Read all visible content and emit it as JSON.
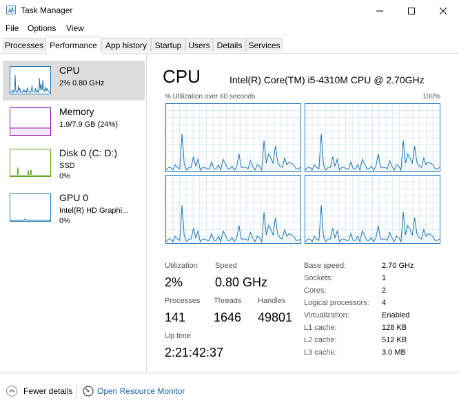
{
  "window": {
    "title": "Task Manager",
    "minimize_icon": "minimize-icon",
    "maximize_icon": "maximize-icon",
    "close_icon": "close-icon"
  },
  "menu": [
    "File",
    "Options",
    "View"
  ],
  "tabs": [
    "Processes",
    "Performance",
    "App history",
    "Startup",
    "Users",
    "Details",
    "Services"
  ],
  "active_tab": "Performance",
  "resources": [
    {
      "name": "CPU",
      "detail1": "2% 0.80 GHz",
      "detail2": "",
      "color": "#1c75b6"
    },
    {
      "name": "Memory",
      "detail1": "1.9/7.9 GB (24%)",
      "detail2": "",
      "color": "#8b12ae"
    },
    {
      "name": "Disk 0 (C: D:)",
      "detail1": "SSD",
      "detail2": "0%",
      "color": "#4da60c"
    },
    {
      "name": "GPU 0",
      "detail1": "Intel(R) HD Graphi...",
      "detail2": "0%",
      "color": "#1c75b6"
    }
  ],
  "cpu": {
    "title": "CPU",
    "model": "Intel(R) Core(TM) i5-4310M CPU @ 2.70GHz",
    "util_label": "% Utilization over 60 seconds",
    "max_label": "100%",
    "stats": {
      "utilization_label": "Utilization",
      "utilization": "2%",
      "speed_label": "Speed",
      "speed": "0.80 GHz",
      "processes_label": "Processes",
      "processes": "141",
      "threads_label": "Threads",
      "threads": "1646",
      "handles_label": "Handles",
      "handles": "49801",
      "uptime_label": "Up time",
      "uptime": "2:21:42:37"
    },
    "details": [
      {
        "label": "Base speed:",
        "value": "2.70 GHz"
      },
      {
        "label": "Sockets:",
        "value": "1"
      },
      {
        "label": "Cores:",
        "value": "2"
      },
      {
        "label": "Logical processors:",
        "value": "4"
      },
      {
        "label": "Virtualization:",
        "value": "Enabled"
      },
      {
        "label": "L1 cache:",
        "value": "128 KB"
      },
      {
        "label": "L2 cache:",
        "value": "512 KB"
      },
      {
        "label": "L3 cache:",
        "value": "3.0 MB"
      }
    ]
  },
  "footer": {
    "fewer_details": "Fewer details",
    "open_resource_monitor": "Open Resource Monitor"
  },
  "colors": {
    "cpu_line": "#1c75b6",
    "cpu_fill": "#f1f6fa",
    "grid": "#d9eaf4",
    "link": "#1565a6"
  },
  "cpu_series": [
    2,
    3,
    2,
    2,
    5,
    2,
    3,
    28,
    4,
    2,
    3,
    2,
    12,
    4,
    8,
    2,
    3,
    2,
    3,
    2,
    6,
    3,
    2,
    4,
    2,
    9,
    5,
    3,
    2,
    3,
    2,
    4,
    12,
    4,
    3,
    2,
    3,
    8,
    3,
    2,
    5,
    3,
    2,
    23,
    5,
    14,
    10,
    5,
    20,
    7,
    3,
    4,
    10,
    4,
    8,
    6,
    4,
    3,
    2,
    2
  ]
}
